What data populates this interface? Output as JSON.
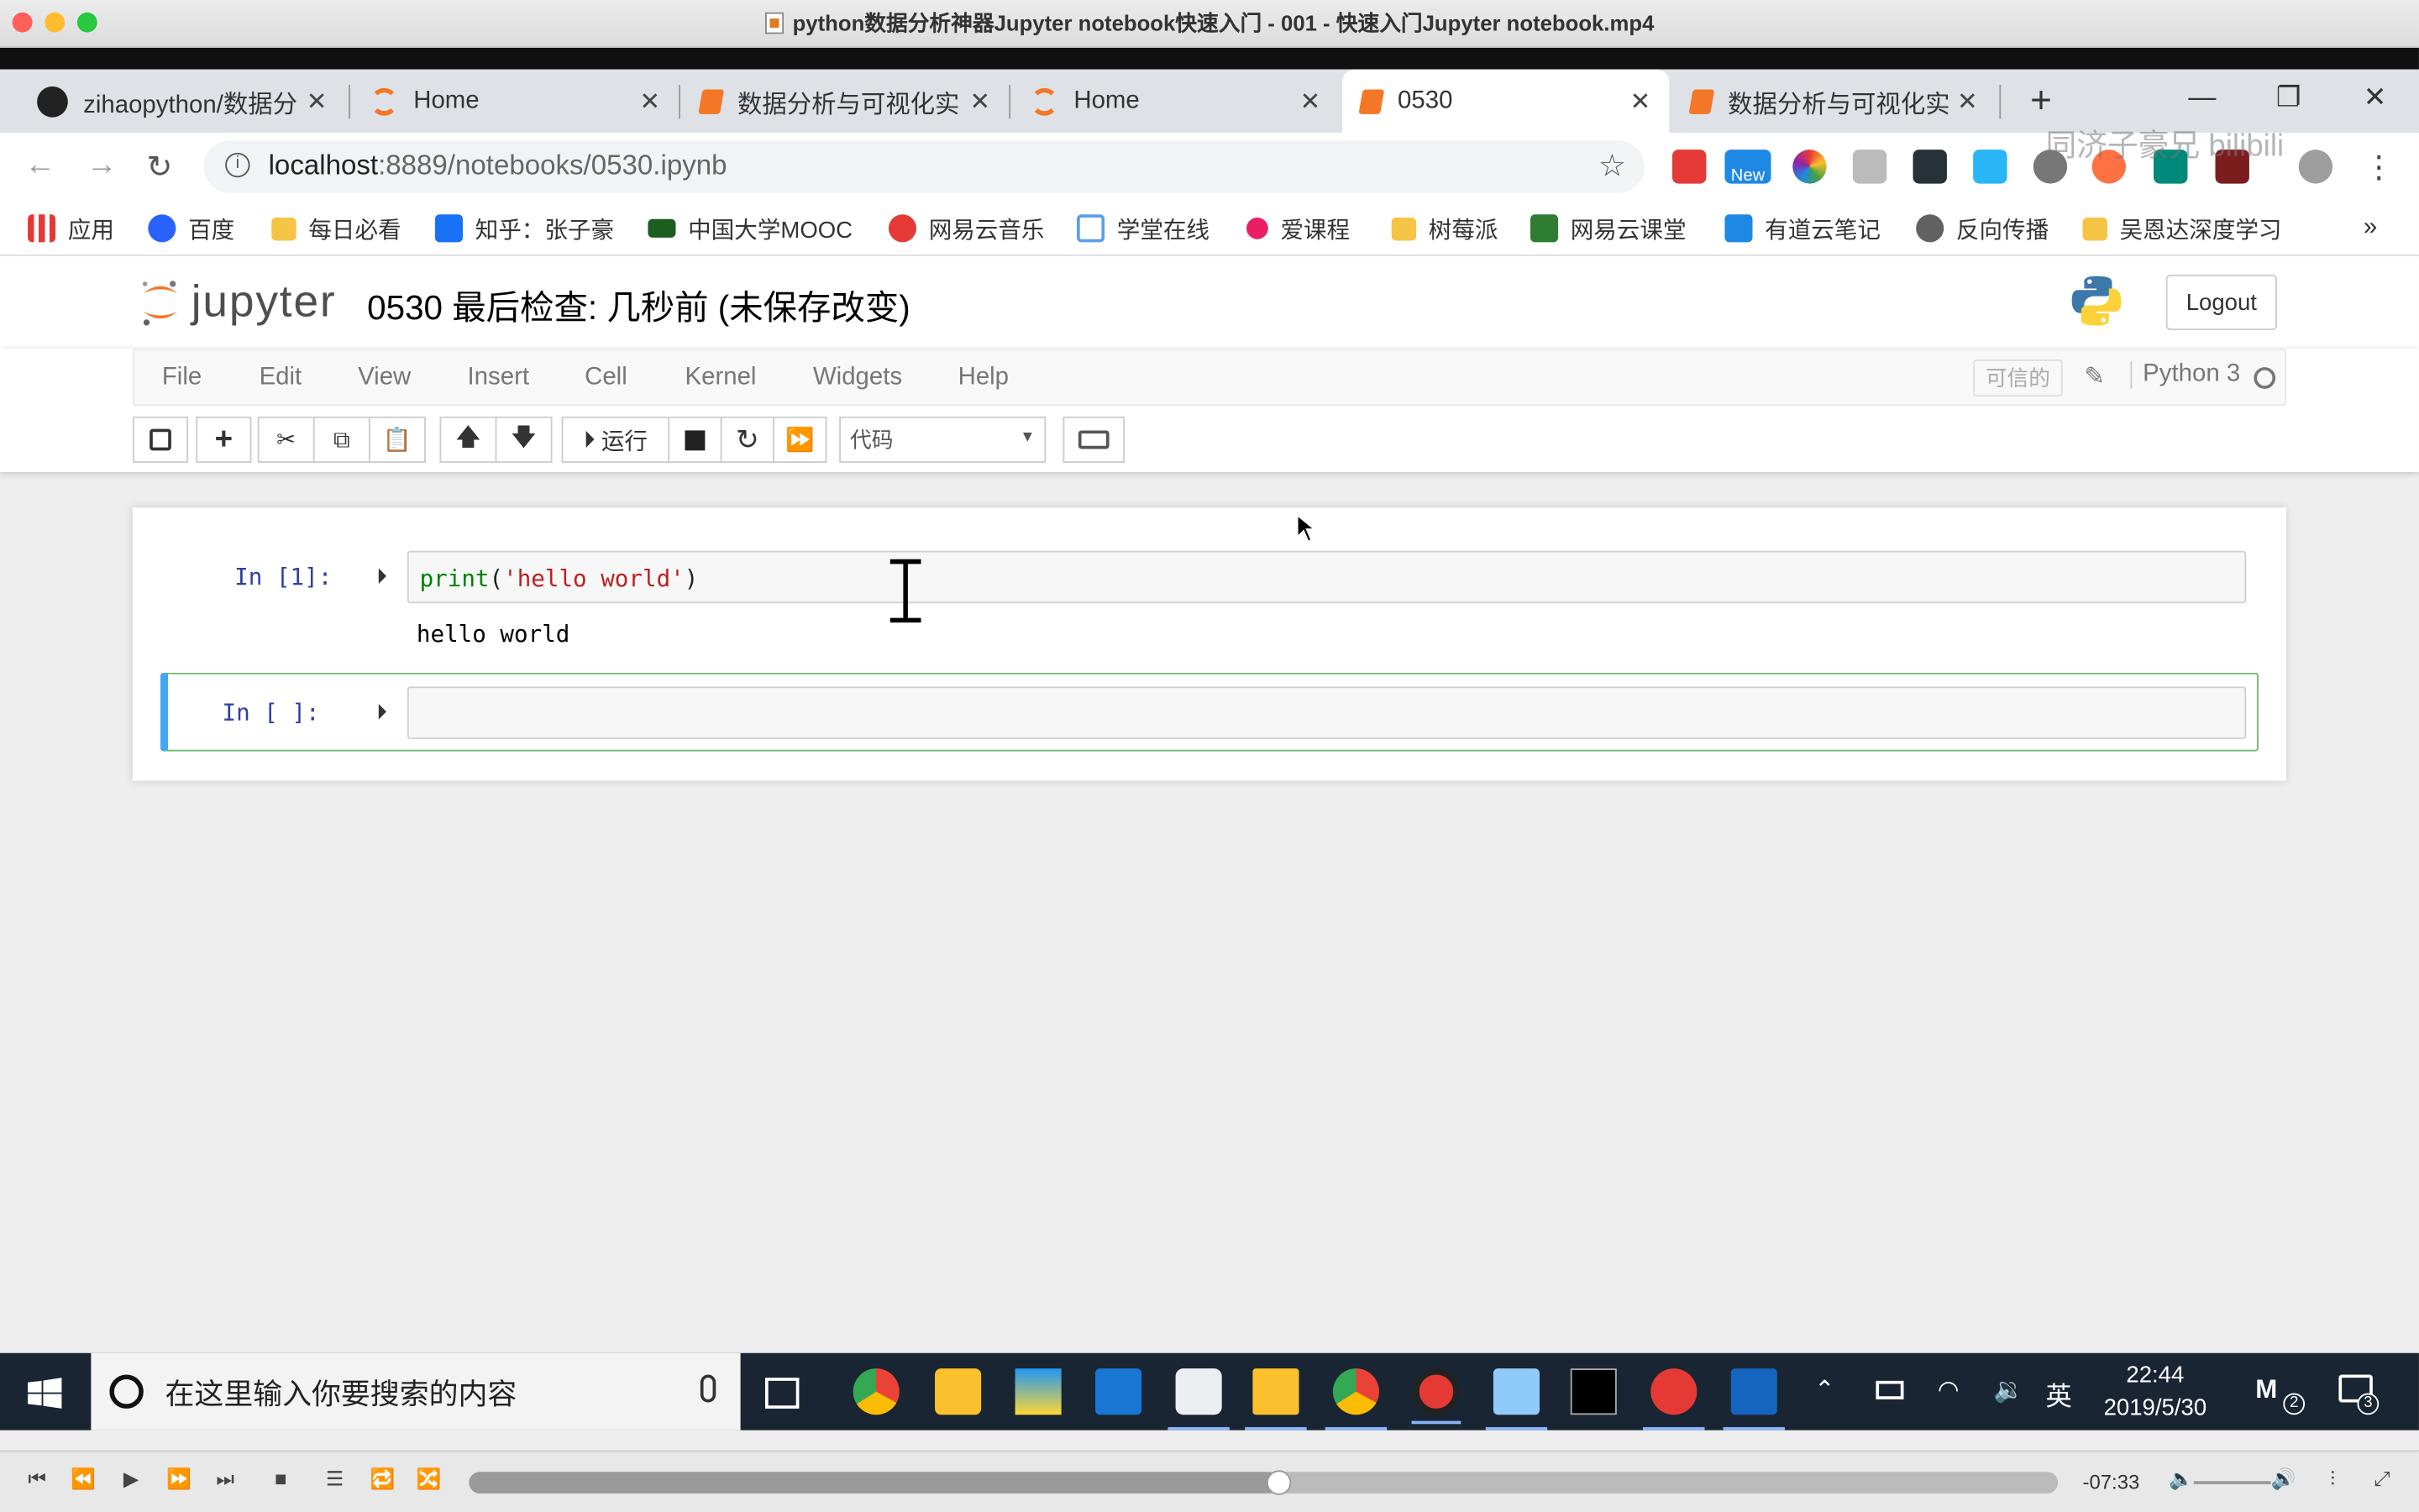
{
  "window": {
    "title": "python数据分析神器Jupyter notebook快速入门 - 001 - 快速入门Jupyter notebook.mp4"
  },
  "tabs": [
    {
      "label": "zihaopython/数据分",
      "icon": "github-icon"
    },
    {
      "label": "Home",
      "icon": "jupyter-icon"
    },
    {
      "label": "数据分析与可视化实",
      "icon": "notebook-icon"
    },
    {
      "label": "Home",
      "icon": "jupyter-icon"
    },
    {
      "label": "0530",
      "icon": "notebook-icon",
      "active": true
    },
    {
      "label": "数据分析与可视化实",
      "icon": "notebook-icon"
    }
  ],
  "address": {
    "host": "localhost",
    "path": ":8889/notebooks/0530.ipynb"
  },
  "bookmarks": [
    "应用",
    "百度",
    "每日必看",
    "知乎：张子豪",
    "中国大学MOOC",
    "网易云音乐",
    "学堂在线",
    "爱课程",
    "树莓派",
    "网易云课堂",
    "有道云笔记",
    "反向传播",
    "吴恩达深度学习"
  ],
  "extensions": {
    "new_badge": "New"
  },
  "watermark": "同济子豪兄 bilibili",
  "jupyter": {
    "logo_text": "jupyter",
    "notebook_title": "0530 最后检查: 几秒前  (未保存改变)",
    "logout": "Logout",
    "menus": [
      "File",
      "Edit",
      "View",
      "Insert",
      "Cell",
      "Kernel",
      "Widgets",
      "Help"
    ],
    "trusted": "可信的",
    "kernel_name": "Python 3",
    "toolbar": {
      "run_label": "运行",
      "cell_type": "代码"
    },
    "cells": [
      {
        "prompt": "In  [1]:",
        "code_fn": "print",
        "code_open": "(",
        "code_str": "'hello world'",
        "code_close": ")",
        "output": "hello world"
      },
      {
        "prompt": "In  [ ]:",
        "code": ""
      }
    ]
  },
  "taskbar": {
    "search_placeholder": "在这里输入你要搜索的内容",
    "ime": "英",
    "time": "22:44",
    "date": "2019/5/30",
    "notification_count": "3",
    "tray_badge": "2"
  },
  "player": {
    "time_remaining": "-07:33",
    "progress": 0.51
  },
  "colors": {
    "accent": "#f37726",
    "cell_selected": "#66bb6a",
    "string": "#ba2121",
    "builtin": "#008000",
    "prompt": "#303f9f"
  }
}
